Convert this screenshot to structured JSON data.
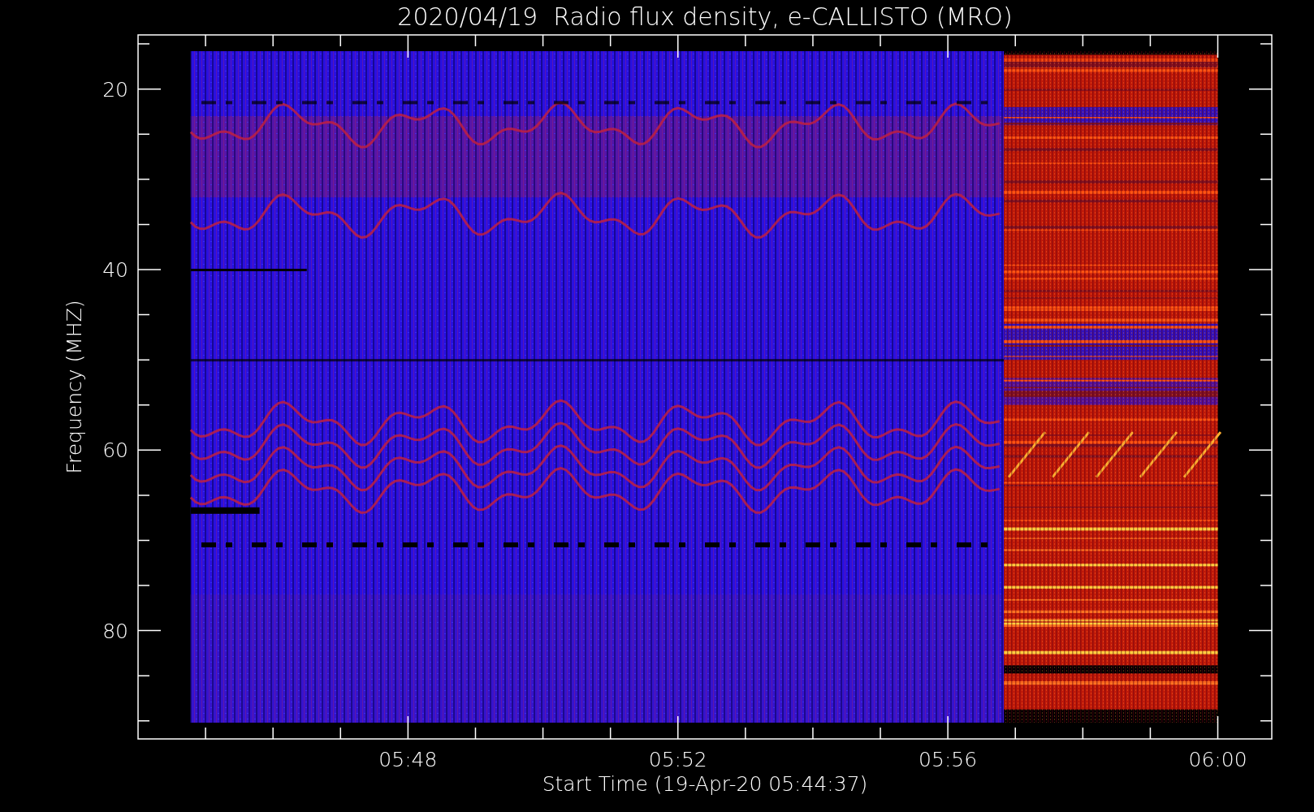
{
  "plot": {
    "title": "2020/04/19  Radio flux density, e-CALLISTO (MRO)",
    "xlabel": "Start Time (19-Apr-20 05:44:37)",
    "ylabel": "Frequency (MHZ)",
    "y_tick_labels": [
      "20",
      "40",
      "60",
      "80"
    ],
    "x_tick_labels": [
      "05:48",
      "05:52",
      "05:56",
      "06:00"
    ]
  }
}
